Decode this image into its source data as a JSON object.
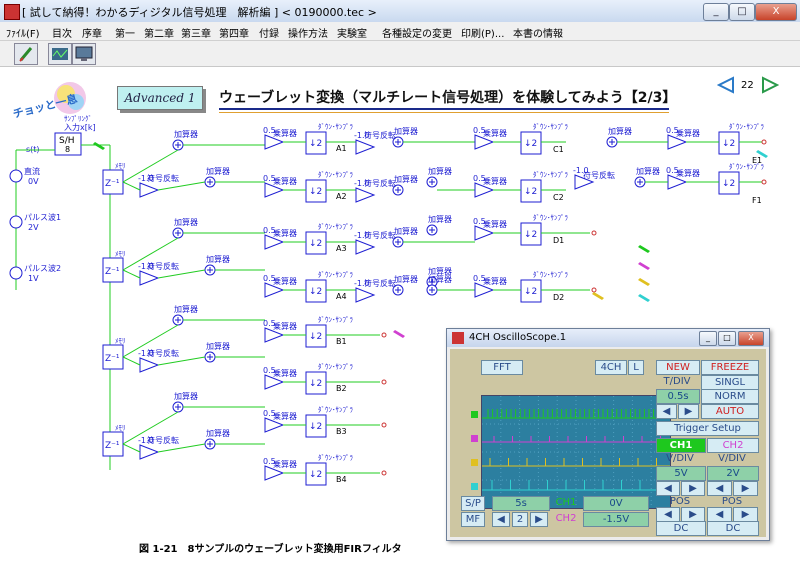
{
  "window": {
    "title": "[ 試して納得！わかるディジタル信号処理　解析編 ] < 0190000.tec >",
    "minimize": "_",
    "maximize": "□",
    "close": "X"
  },
  "menu": [
    "ﾌｧｲﾙ(F)",
    "目次",
    "序章",
    "第一",
    "第二章",
    "第三章",
    "第四章",
    "付録",
    "操作方法",
    "実験室",
    "各種設定の変更",
    "印刷(P)...",
    "本書の情報"
  ],
  "header": {
    "badge": "チョッと一息",
    "advanced": "Advanced 1",
    "title": "ウェーブレット変換（マルチレート信号処理）を体験してみよう【2/3】",
    "page": "22"
  },
  "diagram": {
    "sample_hold": "S/H\n8",
    "sampling_label": "ｻﾝﾌﾟﾘﾝｸﾞ",
    "input_label": "入力x[k]",
    "signal": "s(t)",
    "sources": [
      {
        "name": "直流",
        "value": "0V"
      },
      {
        "name": "パルス波1",
        "value": "2V"
      },
      {
        "name": "パルス波2",
        "value": "1V"
      }
    ],
    "memory": "ﾒﾓﾘ",
    "delay": "Z⁻¹",
    "inverter_gain": "-1.0",
    "inverter": "符号反転",
    "adder": "加算器",
    "gain": "0.5",
    "multiplier": "乗算器",
    "downsampler": "ﾀﾞｳﾝ･ｻﾝﾌﾟﾗ",
    "down": "↓2",
    "nodes": [
      "A1",
      "A2",
      "A3",
      "A4",
      "B1",
      "B2",
      "B3",
      "B4",
      "C1",
      "C2",
      "D1",
      "D2",
      "E1",
      "F1"
    ]
  },
  "caption": "図 1-21　8サンプルのウェーブレット変換用FIRフィルタ",
  "scope": {
    "title": "4CH OscilloScope.1",
    "fft": "FFT",
    "ch4": "4CH",
    "l": "L",
    "new": "NEW",
    "freeze": "FREEZE",
    "tdiv": "T/DIV",
    "tdiv_value": "0.5s",
    "singl": "SINGL",
    "norm": "NORM",
    "auto": "AUTO",
    "trigger": "Trigger Setup",
    "ch1": "CH1",
    "ch2": "CH2",
    "vdiv": "V/DIV",
    "ch1_vdiv": "5V",
    "ch2_vdiv": "2V",
    "pos": "POS",
    "dc": "DC",
    "sp": "S/P",
    "mf": "MF",
    "time": "5s",
    "ch1_offset": "0V",
    "ch2_offset": "-1.5V",
    "page": "2"
  },
  "colors": {
    "wire": "#22cc22",
    "block": "#1e1ed2",
    "heading_line": "#1a2a8a",
    "scope_bg": "#cdc6a2",
    "screen": "#2c7fa0"
  }
}
